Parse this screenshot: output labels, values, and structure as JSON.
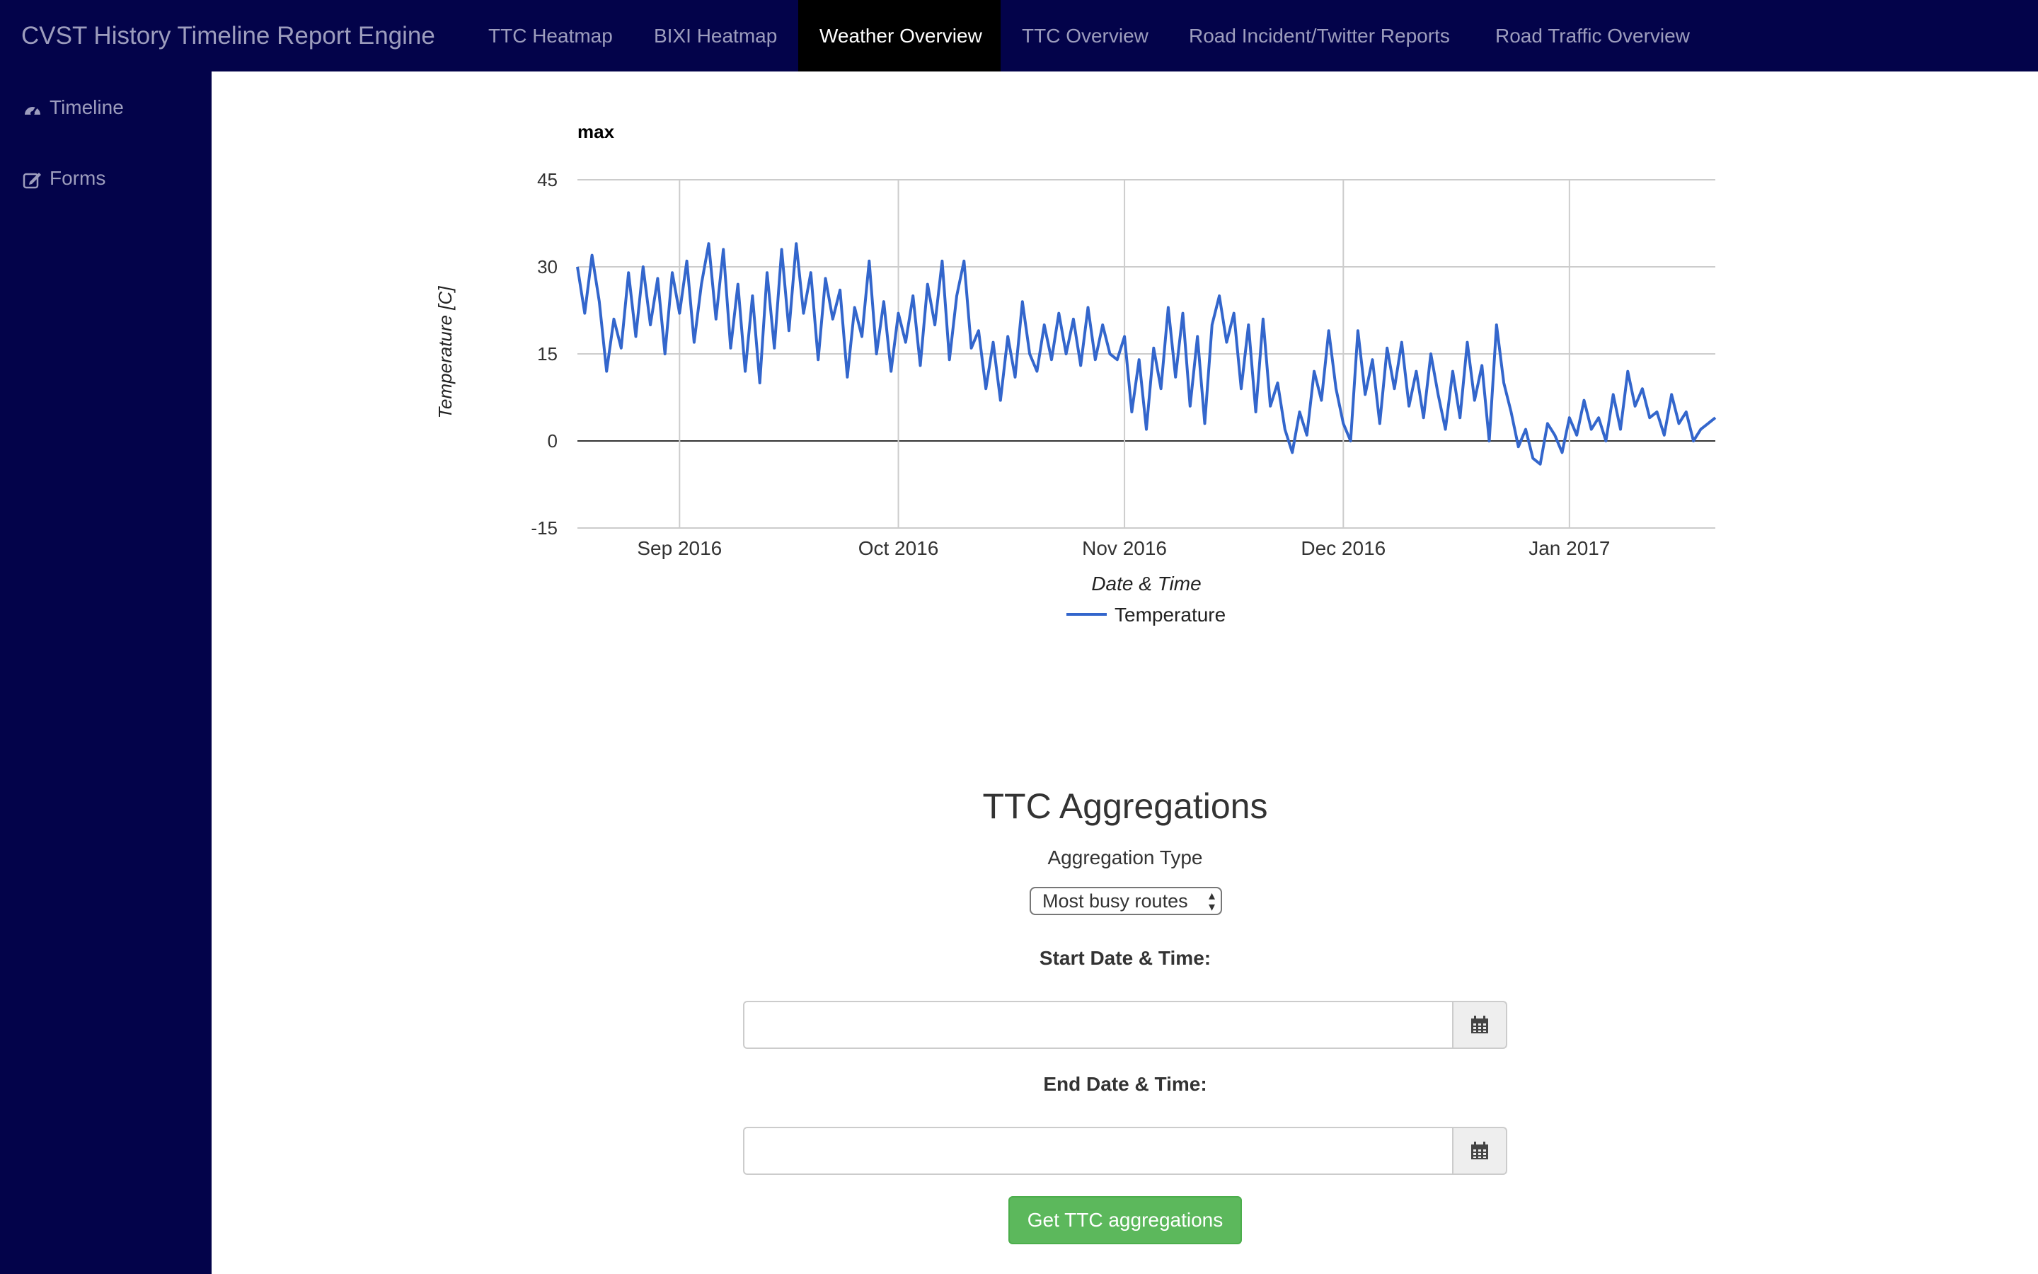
{
  "navbar": {
    "brand": "CVST History Timeline Report Engine",
    "links": [
      {
        "label": "TTC Heatmap",
        "active": false
      },
      {
        "label": "BIXI Heatmap",
        "active": false
      },
      {
        "label": "Weather Overview",
        "active": true
      },
      {
        "label": "TTC Overview",
        "active": false
      },
      {
        "label": "Road Incident/Twitter Reports",
        "active": false
      },
      {
        "label": "Road Traffic Overview",
        "active": false
      }
    ]
  },
  "sidebar": {
    "items": [
      {
        "label": "Timeline",
        "icon": "dashboard-icon"
      },
      {
        "label": "Forms",
        "icon": "edit-icon"
      }
    ]
  },
  "chart_data": {
    "type": "line",
    "title": "max",
    "xlabel": "Date & Time",
    "ylabel": "Temperature [C]",
    "ylim": [
      -15,
      45
    ],
    "yticks": [
      45,
      30,
      15,
      0,
      -15
    ],
    "xlim": [
      "2016-08-18",
      "2017-01-21"
    ],
    "xticks": [
      {
        "date": "2016-09-01",
        "label": "Sep 2016"
      },
      {
        "date": "2016-10-01",
        "label": "Oct 2016"
      },
      {
        "date": "2016-11-01",
        "label": "Nov 2016"
      },
      {
        "date": "2016-12-01",
        "label": "Dec 2016"
      },
      {
        "date": "2017-01-01",
        "label": "Jan 2017"
      }
    ],
    "grid": true,
    "legend": "bottom",
    "series": [
      {
        "name": "Temperature",
        "color": "#3366cc",
        "points": [
          [
            "2016-08-18",
            30
          ],
          [
            "2016-08-19",
            22
          ],
          [
            "2016-08-20",
            32
          ],
          [
            "2016-08-21",
            24
          ],
          [
            "2016-08-22",
            12
          ],
          [
            "2016-08-23",
            21
          ],
          [
            "2016-08-24",
            16
          ],
          [
            "2016-08-25",
            29
          ],
          [
            "2016-08-26",
            18
          ],
          [
            "2016-08-27",
            30
          ],
          [
            "2016-08-28",
            20
          ],
          [
            "2016-08-29",
            28
          ],
          [
            "2016-08-30",
            15
          ],
          [
            "2016-08-31",
            29
          ],
          [
            "2016-09-01",
            22
          ],
          [
            "2016-09-02",
            31
          ],
          [
            "2016-09-03",
            17
          ],
          [
            "2016-09-04",
            27
          ],
          [
            "2016-09-05",
            34
          ],
          [
            "2016-09-06",
            21
          ],
          [
            "2016-09-07",
            33
          ],
          [
            "2016-09-08",
            16
          ],
          [
            "2016-09-09",
            27
          ],
          [
            "2016-09-10",
            12
          ],
          [
            "2016-09-11",
            25
          ],
          [
            "2016-09-12",
            10
          ],
          [
            "2016-09-13",
            29
          ],
          [
            "2016-09-14",
            16
          ],
          [
            "2016-09-15",
            33
          ],
          [
            "2016-09-16",
            19
          ],
          [
            "2016-09-17",
            34
          ],
          [
            "2016-09-18",
            22
          ],
          [
            "2016-09-19",
            29
          ],
          [
            "2016-09-20",
            14
          ],
          [
            "2016-09-21",
            28
          ],
          [
            "2016-09-22",
            21
          ],
          [
            "2016-09-23",
            26
          ],
          [
            "2016-09-24",
            11
          ],
          [
            "2016-09-25",
            23
          ],
          [
            "2016-09-26",
            18
          ],
          [
            "2016-09-27",
            31
          ],
          [
            "2016-09-28",
            15
          ],
          [
            "2016-09-29",
            24
          ],
          [
            "2016-09-30",
            12
          ],
          [
            "2016-10-01",
            22
          ],
          [
            "2016-10-02",
            17
          ],
          [
            "2016-10-03",
            25
          ],
          [
            "2016-10-04",
            13
          ],
          [
            "2016-10-05",
            27
          ],
          [
            "2016-10-06",
            20
          ],
          [
            "2016-10-07",
            31
          ],
          [
            "2016-10-08",
            14
          ],
          [
            "2016-10-09",
            25
          ],
          [
            "2016-10-10",
            31
          ],
          [
            "2016-10-11",
            16
          ],
          [
            "2016-10-12",
            19
          ],
          [
            "2016-10-13",
            9
          ],
          [
            "2016-10-14",
            17
          ],
          [
            "2016-10-15",
            7
          ],
          [
            "2016-10-16",
            18
          ],
          [
            "2016-10-17",
            11
          ],
          [
            "2016-10-18",
            24
          ],
          [
            "2016-10-19",
            15
          ],
          [
            "2016-10-20",
            12
          ],
          [
            "2016-10-21",
            20
          ],
          [
            "2016-10-22",
            14
          ],
          [
            "2016-10-23",
            22
          ],
          [
            "2016-10-24",
            15
          ],
          [
            "2016-10-25",
            21
          ],
          [
            "2016-10-26",
            13
          ],
          [
            "2016-10-27",
            23
          ],
          [
            "2016-10-28",
            14
          ],
          [
            "2016-10-29",
            20
          ],
          [
            "2016-10-30",
            15
          ],
          [
            "2016-10-31",
            14
          ],
          [
            "2016-11-01",
            18
          ],
          [
            "2016-11-02",
            5
          ],
          [
            "2016-11-03",
            14
          ],
          [
            "2016-11-04",
            2
          ],
          [
            "2016-11-05",
            16
          ],
          [
            "2016-11-06",
            9
          ],
          [
            "2016-11-07",
            23
          ],
          [
            "2016-11-08",
            11
          ],
          [
            "2016-11-09",
            22
          ],
          [
            "2016-11-10",
            6
          ],
          [
            "2016-11-11",
            18
          ],
          [
            "2016-11-12",
            3
          ],
          [
            "2016-11-13",
            20
          ],
          [
            "2016-11-14",
            25
          ],
          [
            "2016-11-15",
            17
          ],
          [
            "2016-11-16",
            22
          ],
          [
            "2016-11-17",
            9
          ],
          [
            "2016-11-18",
            20
          ],
          [
            "2016-11-19",
            5
          ],
          [
            "2016-11-20",
            21
          ],
          [
            "2016-11-21",
            6
          ],
          [
            "2016-11-22",
            10
          ],
          [
            "2016-11-23",
            2
          ],
          [
            "2016-11-24",
            -2
          ],
          [
            "2016-11-25",
            5
          ],
          [
            "2016-11-26",
            1
          ],
          [
            "2016-11-27",
            12
          ],
          [
            "2016-11-28",
            7
          ],
          [
            "2016-11-29",
            19
          ],
          [
            "2016-11-30",
            9
          ],
          [
            "2016-12-01",
            3
          ],
          [
            "2016-12-02",
            0
          ],
          [
            "2016-12-03",
            19
          ],
          [
            "2016-12-04",
            8
          ],
          [
            "2016-12-05",
            14
          ],
          [
            "2016-12-06",
            3
          ],
          [
            "2016-12-07",
            16
          ],
          [
            "2016-12-08",
            9
          ],
          [
            "2016-12-09",
            17
          ],
          [
            "2016-12-10",
            6
          ],
          [
            "2016-12-11",
            12
          ],
          [
            "2016-12-12",
            4
          ],
          [
            "2016-12-13",
            15
          ],
          [
            "2016-12-14",
            8
          ],
          [
            "2016-12-15",
            2
          ],
          [
            "2016-12-16",
            12
          ],
          [
            "2016-12-17",
            4
          ],
          [
            "2016-12-18",
            17
          ],
          [
            "2016-12-19",
            7
          ],
          [
            "2016-12-20",
            13
          ],
          [
            "2016-12-21",
            0
          ],
          [
            "2016-12-22",
            20
          ],
          [
            "2016-12-23",
            10
          ],
          [
            "2016-12-24",
            5
          ],
          [
            "2016-12-25",
            -1
          ],
          [
            "2016-12-26",
            2
          ],
          [
            "2016-12-27",
            -3
          ],
          [
            "2016-12-28",
            -4
          ],
          [
            "2016-12-29",
            3
          ],
          [
            "2016-12-30",
            1
          ],
          [
            "2016-12-31",
            -2
          ],
          [
            "2017-01-01",
            4
          ],
          [
            "2017-01-02",
            1
          ],
          [
            "2017-01-03",
            7
          ],
          [
            "2017-01-04",
            2
          ],
          [
            "2017-01-05",
            4
          ],
          [
            "2017-01-06",
            0
          ],
          [
            "2017-01-07",
            8
          ],
          [
            "2017-01-08",
            2
          ],
          [
            "2017-01-09",
            12
          ],
          [
            "2017-01-10",
            6
          ],
          [
            "2017-01-11",
            9
          ],
          [
            "2017-01-12",
            4
          ],
          [
            "2017-01-13",
            5
          ],
          [
            "2017-01-14",
            1
          ],
          [
            "2017-01-15",
            8
          ],
          [
            "2017-01-16",
            3
          ],
          [
            "2017-01-17",
            5
          ],
          [
            "2017-01-18",
            0
          ],
          [
            "2017-01-19",
            2
          ],
          [
            "2017-01-20",
            3
          ],
          [
            "2017-01-21",
            4
          ]
        ]
      }
    ]
  },
  "ttc": {
    "title": "TTC Aggregations",
    "aggregation_label": "Aggregation Type",
    "aggregation_value": "Most busy routes",
    "start_label": "Start Date & Time:",
    "start_value": "",
    "end_label": "End Date & Time:",
    "end_value": "",
    "submit_label": "Get TTC aggregations"
  }
}
